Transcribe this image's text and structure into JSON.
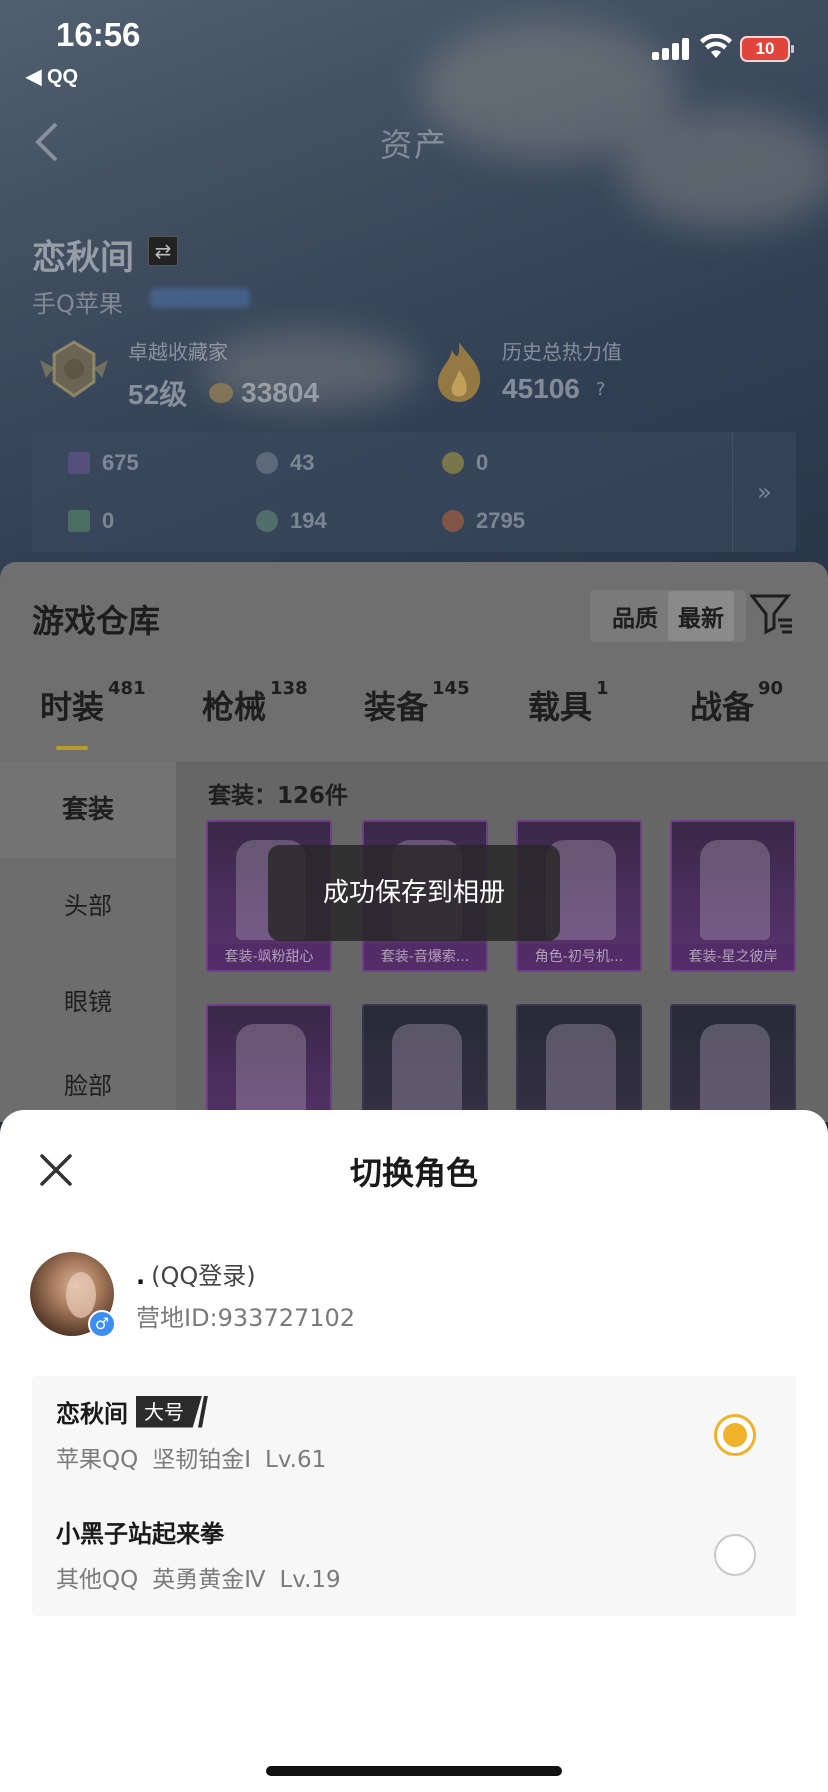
{
  "status_bar": {
    "time": "16:56",
    "back_app": "◀ QQ",
    "battery": "10"
  },
  "nav": {
    "title": "资产"
  },
  "player": {
    "name": "恋秋间",
    "platform": "手Q苹果",
    "collector_label": "卓越收藏家",
    "collector_level": "52级",
    "collector_points": "33804",
    "heat_label": "历史总热力值",
    "heat_value": "45106",
    "heat_help": "?"
  },
  "resources": [
    {
      "icon": "card-icon",
      "value": "675"
    },
    {
      "icon": "coin-icon",
      "value": "43"
    },
    {
      "icon": "badge-icon",
      "value": "0"
    },
    {
      "icon": "ticket-icon",
      "value": "0"
    },
    {
      "icon": "orb-icon",
      "value": "194"
    },
    {
      "icon": "gem-icon",
      "value": "2795"
    }
  ],
  "resources_more": "»",
  "warehouse": {
    "title": "游戏仓库",
    "sort": [
      "品质",
      "最新"
    ],
    "tabs": [
      {
        "label": "时装",
        "count": "481"
      },
      {
        "label": "枪械",
        "count": "138"
      },
      {
        "label": "装备",
        "count": "145"
      },
      {
        "label": "载具",
        "count": "1"
      },
      {
        "label": "战备",
        "count": "90"
      }
    ],
    "side": [
      "套装",
      "头部",
      "眼镜",
      "脸部"
    ],
    "count_label": "套装：126件",
    "items_row1": [
      "套装-飒粉甜心",
      "套装-音爆索...",
      "角色-初号机...",
      "套装-星之彼岸"
    ]
  },
  "toast": "成功保存到相册",
  "sheet": {
    "title": "切换角色",
    "account_dot": ".",
    "account_login": "(QQ登录)",
    "account_id": "营地ID:933727102",
    "gender": "♂",
    "roles": [
      {
        "name": "恋秋间",
        "tag": "大号",
        "platform": "苹果QQ",
        "rank": "坚韧铂金Ⅰ",
        "level": "Lv.61",
        "selected": true
      },
      {
        "name": "小黑子站起来拳",
        "tag": "",
        "platform": "其他QQ",
        "rank": "英勇黄金Ⅳ",
        "level": "Lv.19",
        "selected": false
      }
    ]
  },
  "colors": {
    "accent": "#f0b22a",
    "gender_blue": "#3d8ef2"
  }
}
